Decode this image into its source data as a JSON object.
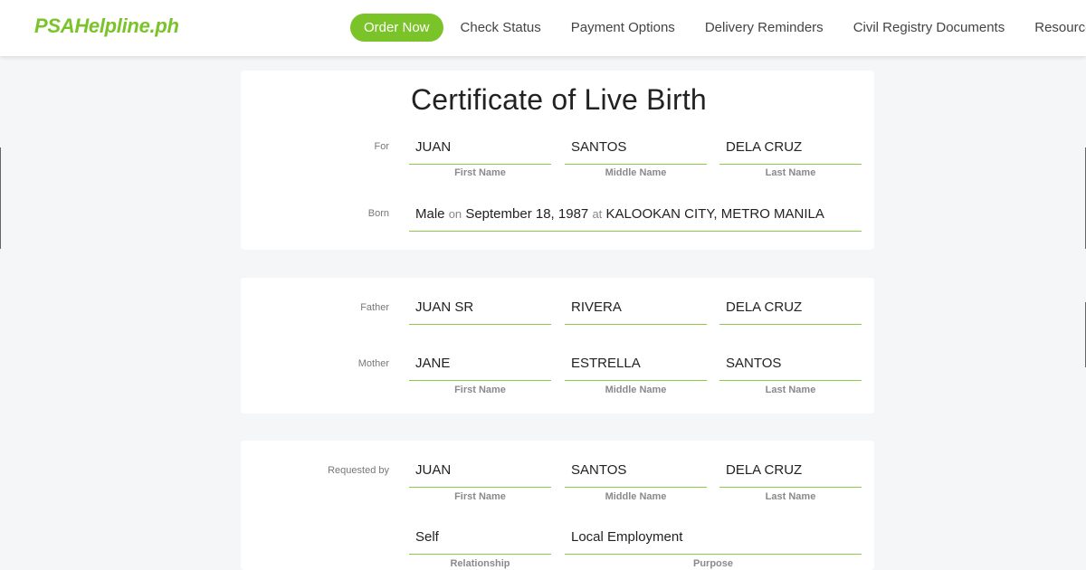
{
  "brand": {
    "logo": "PSAHelpline.ph",
    "accent": "#7ac328"
  },
  "nav": {
    "items": [
      "Order Now",
      "Check Status",
      "Payment Options",
      "Delivery Reminders",
      "Civil Registry Documents",
      "Resources"
    ]
  },
  "certificate": {
    "title": "Certificate of Live Birth",
    "for": {
      "label": "For",
      "first": "JUAN",
      "middle": "SANTOS",
      "last": "DELA CRUZ"
    },
    "born": {
      "label": "Born",
      "sex": "Male",
      "on_word": "on",
      "date": "September 18, 1987",
      "at_word": "at",
      "place": "KALOOKAN CITY, METRO MANILA"
    }
  },
  "parents": {
    "father": {
      "label": "Father",
      "first": "JUAN SR",
      "middle": "RIVERA",
      "last": "DELA CRUZ"
    },
    "mother": {
      "label": "Mother",
      "first": "JANE",
      "middle": "ESTRELLA",
      "last": "SANTOS"
    }
  },
  "requester": {
    "label": "Requested by",
    "first": "JUAN",
    "middle": "SANTOS",
    "last": "DELA CRUZ",
    "relationship": "Self",
    "purpose": "Local Employment"
  },
  "captions": {
    "first": "First Name",
    "middle": "Middle Name",
    "last": "Last Name",
    "relationship": "Relationship",
    "purpose": "Purpose"
  }
}
